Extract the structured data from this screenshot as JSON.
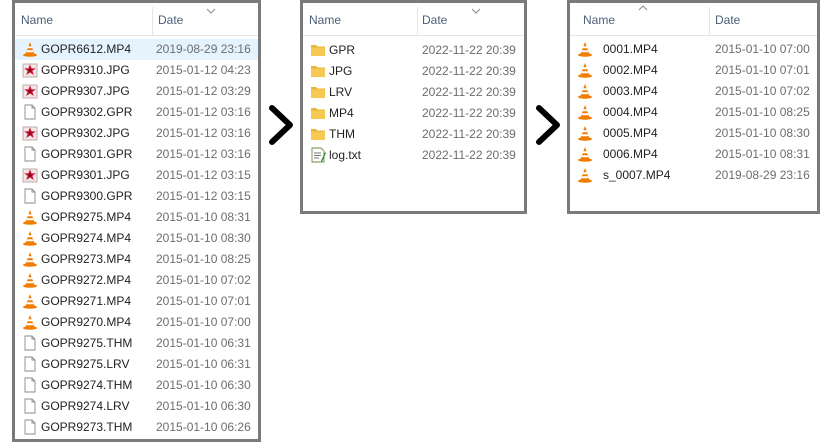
{
  "columns": {
    "name": "Name",
    "date": "Date"
  },
  "panel1": {
    "rows": [
      {
        "name": "GOPR6612.MP4",
        "date": "2019-08-29 23:16",
        "icon": "vlc-cone-icon",
        "selected": true
      },
      {
        "name": "GOPR9310.JPG",
        "date": "2015-01-12 04:23",
        "icon": "image-file-icon"
      },
      {
        "name": "GOPR9307.JPG",
        "date": "2015-01-12 03:29",
        "icon": "image-file-icon"
      },
      {
        "name": "GOPR9302.GPR",
        "date": "2015-01-12 03:16",
        "icon": "blank-file-icon"
      },
      {
        "name": "GOPR9302.JPG",
        "date": "2015-01-12 03:16",
        "icon": "image-file-icon"
      },
      {
        "name": "GOPR9301.GPR",
        "date": "2015-01-12 03:16",
        "icon": "blank-file-icon"
      },
      {
        "name": "GOPR9301.JPG",
        "date": "2015-01-12 03:15",
        "icon": "image-file-icon"
      },
      {
        "name": "GOPR9300.GPR",
        "date": "2015-01-12 03:15",
        "icon": "blank-file-icon"
      },
      {
        "name": "GOPR9275.MP4",
        "date": "2015-01-10 08:31",
        "icon": "vlc-cone-icon"
      },
      {
        "name": "GOPR9274.MP4",
        "date": "2015-01-10 08:30",
        "icon": "vlc-cone-icon"
      },
      {
        "name": "GOPR9273.MP4",
        "date": "2015-01-10 08:25",
        "icon": "vlc-cone-icon"
      },
      {
        "name": "GOPR9272.MP4",
        "date": "2015-01-10 07:02",
        "icon": "vlc-cone-icon"
      },
      {
        "name": "GOPR9271.MP4",
        "date": "2015-01-10 07:01",
        "icon": "vlc-cone-icon"
      },
      {
        "name": "GOPR9270.MP4",
        "date": "2015-01-10 07:00",
        "icon": "vlc-cone-icon"
      },
      {
        "name": "GOPR9275.THM",
        "date": "2015-01-10 06:31",
        "icon": "blank-file-icon"
      },
      {
        "name": "GOPR9275.LRV",
        "date": "2015-01-10 06:31",
        "icon": "blank-file-icon"
      },
      {
        "name": "GOPR9274.THM",
        "date": "2015-01-10 06:30",
        "icon": "blank-file-icon"
      },
      {
        "name": "GOPR9274.LRV",
        "date": "2015-01-10 06:30",
        "icon": "blank-file-icon"
      },
      {
        "name": "GOPR9273.THM",
        "date": "2015-01-10 06:26",
        "icon": "blank-file-icon"
      }
    ]
  },
  "panel2": {
    "rows": [
      {
        "name": "GPR",
        "date": "2022-11-22 20:39",
        "icon": "folder-icon"
      },
      {
        "name": "JPG",
        "date": "2022-11-22 20:39",
        "icon": "folder-icon"
      },
      {
        "name": "LRV",
        "date": "2022-11-22 20:39",
        "icon": "folder-icon"
      },
      {
        "name": "MP4",
        "date": "2022-11-22 20:39",
        "icon": "folder-icon"
      },
      {
        "name": "THM",
        "date": "2022-11-22 20:39",
        "icon": "folder-icon"
      },
      {
        "name": "log.txt",
        "date": "2022-11-22 20:39",
        "icon": "text-file-icon"
      }
    ]
  },
  "panel3": {
    "rows": [
      {
        "name": "0001.MP4",
        "date": "2015-01-10 07:00",
        "icon": "vlc-cone-icon"
      },
      {
        "name": "0002.MP4",
        "date": "2015-01-10 07:01",
        "icon": "vlc-cone-icon"
      },
      {
        "name": "0003.MP4",
        "date": "2015-01-10 07:02",
        "icon": "vlc-cone-icon"
      },
      {
        "name": "0004.MP4",
        "date": "2015-01-10 08:25",
        "icon": "vlc-cone-icon"
      },
      {
        "name": "0005.MP4",
        "date": "2015-01-10 08:30",
        "icon": "vlc-cone-icon"
      },
      {
        "name": "0006.MP4",
        "date": "2015-01-10 08:31",
        "icon": "vlc-cone-icon"
      },
      {
        "name": "s_0007.MP4",
        "date": "2019-08-29 23:16",
        "icon": "vlc-cone-icon"
      }
    ]
  },
  "sort": {
    "panel1": "descending",
    "panel2": "descending",
    "panel3": "ascending"
  },
  "colors": {
    "header_text": "#4c607a",
    "selection": "#e5f3ff",
    "border": "#7a7a7a",
    "vlc_orange": "#f07d00",
    "folder_yellow": "#f5c952"
  }
}
